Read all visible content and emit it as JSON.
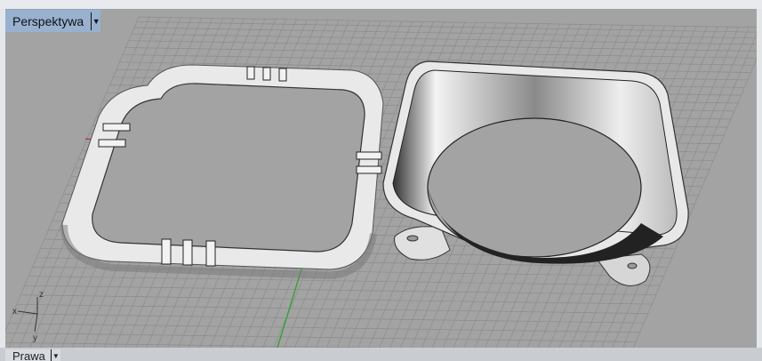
{
  "viewports": {
    "main": {
      "label": "Perspektywa",
      "dropdown_icon": "triangle-down"
    },
    "secondary": {
      "label": "Prawa",
      "dropdown_icon": "triangle-down"
    }
  },
  "axis_widget": {
    "x": "x",
    "y": "y",
    "z": "z"
  },
  "colors": {
    "viewport_bg": "#a3a3a3",
    "grid": "#8c8c8c",
    "x_axis": "#b03030",
    "y_axis": "#2fa02f",
    "tab_active": "#97b1cf"
  }
}
